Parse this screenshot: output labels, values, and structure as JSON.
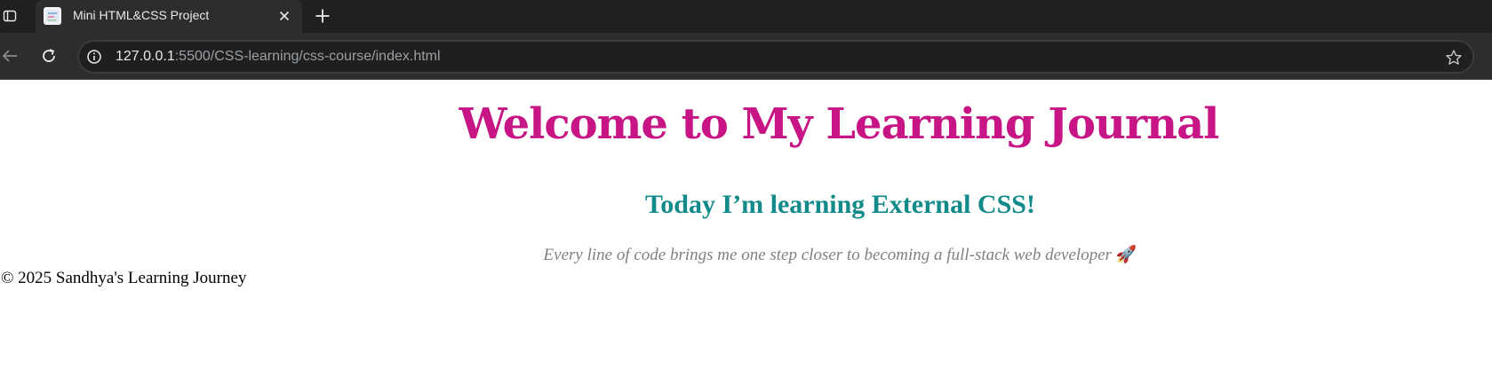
{
  "browser": {
    "tab": {
      "title": "Mini HTML&CSS Project",
      "favicon": "page-favicon"
    },
    "address_bar": {
      "host": "127.0.0.1",
      "rest": ":5500/CSS-learning/css-course/index.html"
    },
    "icons": {
      "tab_strip": "tab-strip-icon",
      "close": "close-icon",
      "new_tab": "plus-icon",
      "back": "back-arrow-icon",
      "reload": "reload-icon",
      "site_info": "info-icon",
      "bookmark": "star-icon"
    }
  },
  "page": {
    "heading": "Welcome to My Learning Journal",
    "subheading": "Today I’m learning External CSS!",
    "quote": "Every line of code brings me one step closer to becoming a full-stack web developer",
    "quote_emoji": "🚀",
    "footer": "© 2025 Sandhya's Learning Journey"
  },
  "colors": {
    "heading": "#c71585",
    "subheading": "#138a8a",
    "quote": "#808080",
    "footer": "#000000"
  }
}
